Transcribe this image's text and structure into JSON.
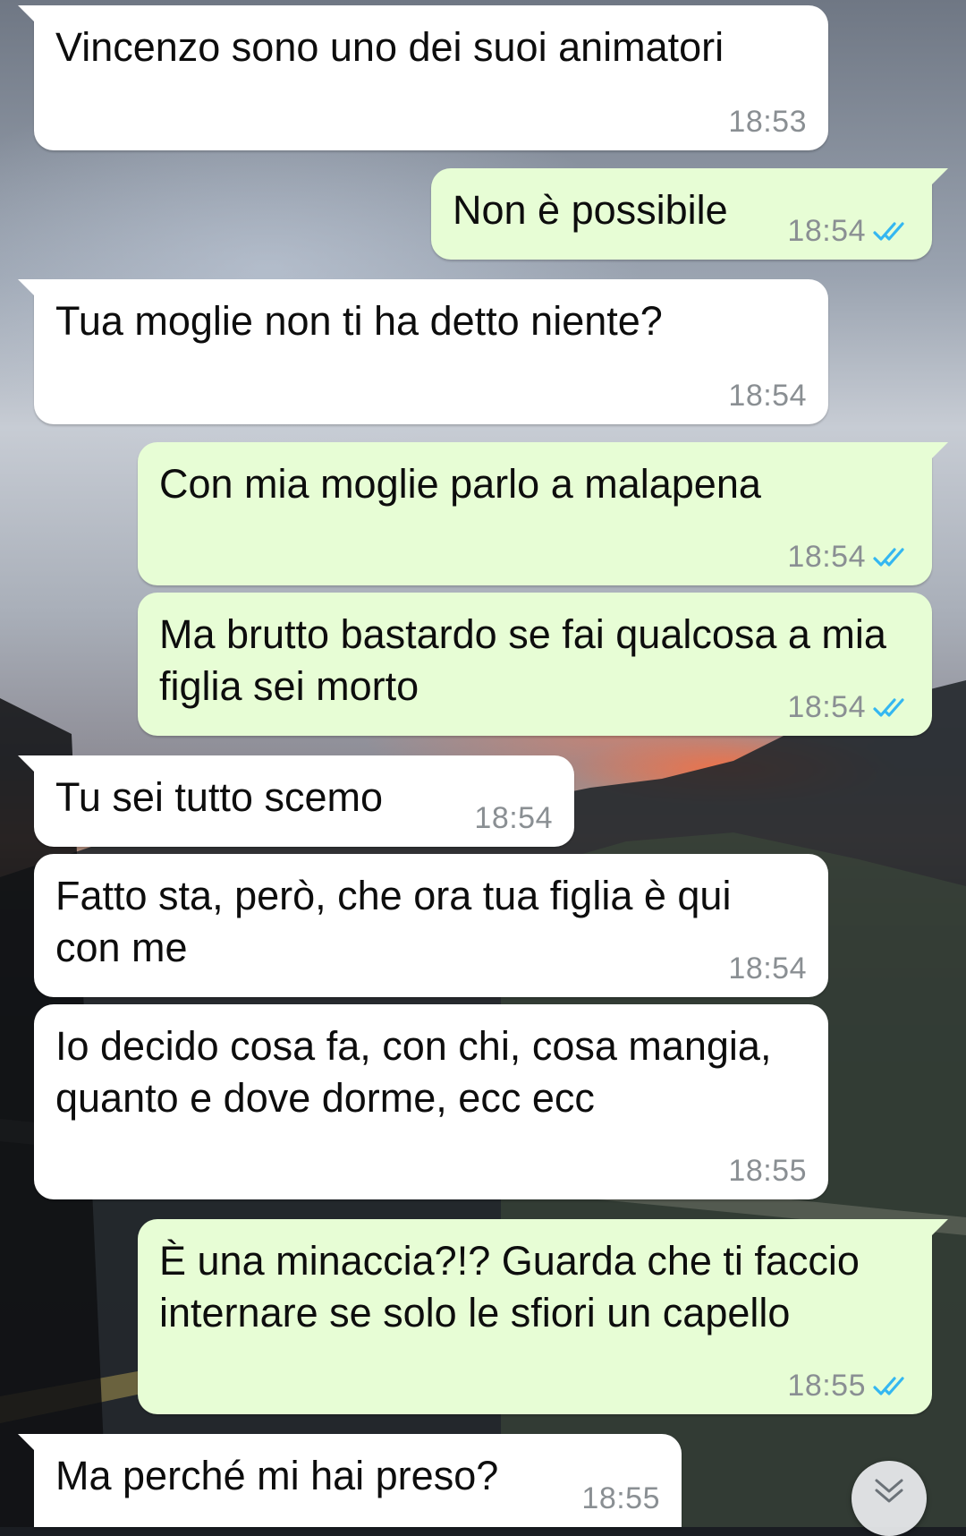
{
  "messages": [
    {
      "direction": "in",
      "text": "Vincenzo sono uno dei suoi animatori",
      "time": "18:53"
    },
    {
      "direction": "out",
      "text": "Non è possibile",
      "time": "18:54",
      "status": "read-double-check-icon"
    },
    {
      "direction": "in",
      "text": "Tua moglie non ti ha detto niente?",
      "time": "18:54"
    },
    {
      "direction": "out",
      "text": "Con mia moglie parlo a malapena",
      "time": "18:54",
      "status": "read-double-check-icon"
    },
    {
      "direction": "out",
      "text": "Ma brutto bastardo se fai qualcosa a mia figlia sei morto",
      "time": "18:54",
      "status": "read-double-check-icon"
    },
    {
      "direction": "in",
      "text": "Tu sei tutto scemo",
      "time": "18:54"
    },
    {
      "direction": "in",
      "text": "Fatto sta, però, che ora tua figlia è qui con me",
      "time": "18:54"
    },
    {
      "direction": "in",
      "text": "Io decido cosa fa, con chi, cosa mangia, quanto e dove dorme, ecc ecc",
      "time": "18:55"
    },
    {
      "direction": "out",
      "text": "È una minaccia?!? Guarda che ti faccio internare se solo le sfiori un capello",
      "time": "18:55",
      "status": "read-double-check-icon"
    },
    {
      "direction": "in",
      "text": "Ma perché mi hai preso?",
      "time": "18:55"
    }
  ],
  "scroll_button": {
    "icon": "double-chevron-down-icon"
  },
  "colors": {
    "incoming_bubble": "#ffffff",
    "outgoing_bubble": "#e7fdd5",
    "timestamp": "#8a8f93",
    "read_ticks": "#34b7f1"
  }
}
